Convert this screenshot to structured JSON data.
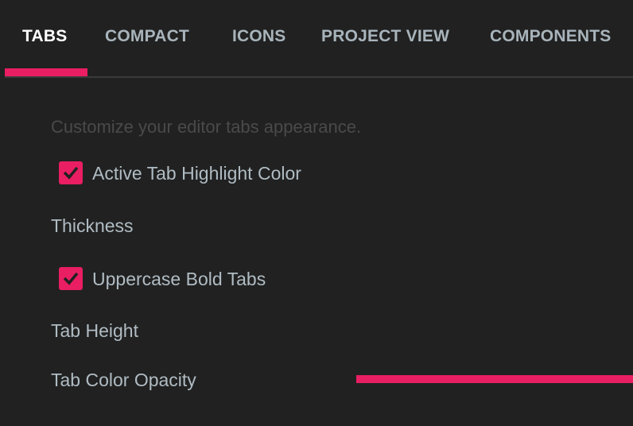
{
  "tabs": [
    {
      "label": "TABS",
      "active": true
    },
    {
      "label": "COMPACT",
      "active": false
    },
    {
      "label": "ICONS",
      "active": false
    },
    {
      "label": "PROJECT VIEW",
      "active": false
    },
    {
      "label": "COMPONENTS",
      "active": false
    }
  ],
  "accent_color": "#e91e63",
  "description": "Customize your editor tabs appearance.",
  "settings": {
    "active_tab_highlight": {
      "label": "Active Tab Highlight Color",
      "checked": true
    },
    "thickness": {
      "label": "Thickness"
    },
    "uppercase_bold": {
      "label": "Uppercase Bold Tabs",
      "checked": true
    },
    "tab_height": {
      "label": "Tab Height"
    },
    "tab_color_opacity": {
      "label": "Tab Color Opacity"
    }
  }
}
